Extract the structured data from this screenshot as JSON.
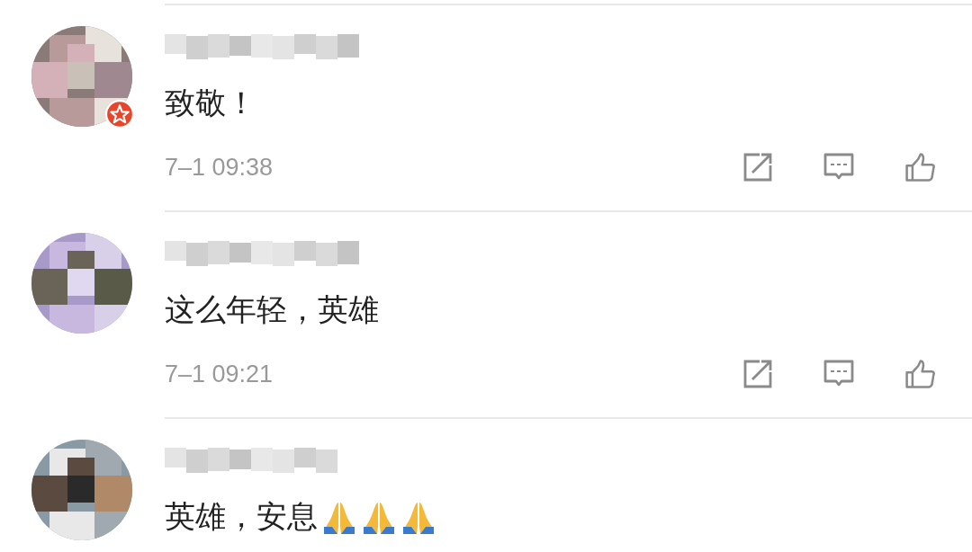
{
  "comments": [
    {
      "badge": true,
      "text": "致敬！",
      "time": "7–1 09:38"
    },
    {
      "badge": false,
      "text": "这么年轻，英雄",
      "time": "7–1 09:21"
    },
    {
      "badge": false,
      "text": "英雄，安息",
      "emojis": [
        {
          "kind": "pray"
        },
        {
          "kind": "pray"
        },
        {
          "kind": "pray"
        }
      ]
    }
  ]
}
